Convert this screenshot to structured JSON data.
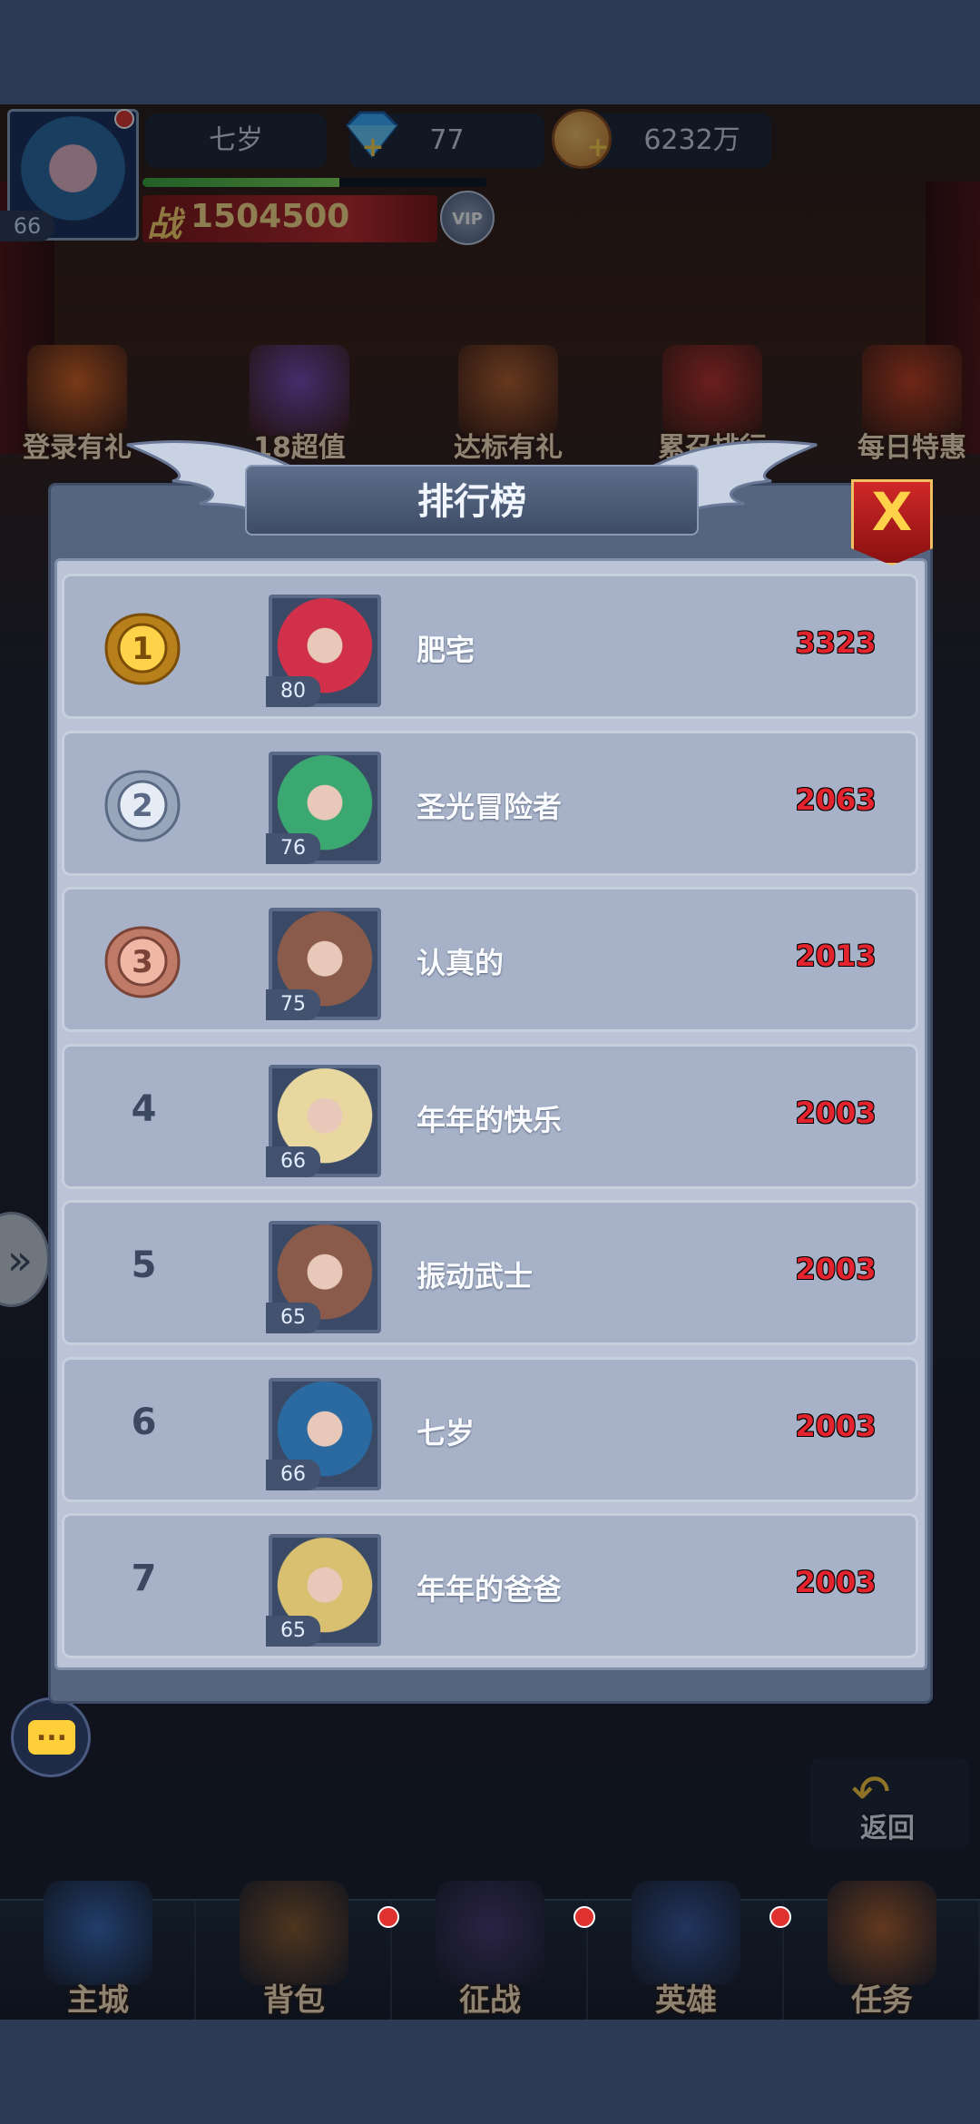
{
  "header": {
    "player_name": "七岁",
    "player_level": "66",
    "gems": "77",
    "coins": "6232万",
    "power_label": "战",
    "power_value": "1504500",
    "vip_label": "VIP",
    "xp_progress": 0.57
  },
  "events": [
    {
      "label": "登录有礼",
      "color": "#d8621e"
    },
    {
      "label": "18超值",
      "color": "#7a4bb8"
    },
    {
      "label": "达标有礼",
      "color": "#b8602a"
    },
    {
      "label": "累召排行",
      "color": "#c0302a"
    },
    {
      "label": "每日特惠",
      "color": "#c8401e"
    }
  ],
  "leaderboard": {
    "title": "排行榜",
    "close_label": "X",
    "rows": [
      {
        "rank": "1",
        "name": "肥宅",
        "score": "3323",
        "level": "80",
        "medal": "gold"
      },
      {
        "rank": "2",
        "name": "圣光冒险者",
        "score": "2063",
        "level": "76",
        "medal": "silver"
      },
      {
        "rank": "3",
        "name": "认真的",
        "score": "2013",
        "level": "75",
        "medal": "bronze"
      },
      {
        "rank": "4",
        "name": "年年的快乐",
        "score": "2003",
        "level": "66",
        "medal": ""
      },
      {
        "rank": "5",
        "name": "振动武士",
        "score": "2003",
        "level": "65",
        "medal": ""
      },
      {
        "rank": "6",
        "name": "七岁",
        "score": "2003",
        "level": "66",
        "medal": ""
      },
      {
        "rank": "7",
        "name": "年年的爸爸",
        "score": "2003",
        "level": "65",
        "medal": ""
      }
    ]
  },
  "chat_label": "...",
  "back_label": "返回",
  "bottom_nav": [
    {
      "label": "主城",
      "icon": "castle-icon",
      "dot": false
    },
    {
      "label": "背包",
      "icon": "backpack-icon",
      "dot": true
    },
    {
      "label": "征战",
      "icon": "dragon-portal-icon",
      "dot": true
    },
    {
      "label": "英雄",
      "icon": "helmet-icon",
      "dot": true
    },
    {
      "label": "任务",
      "icon": "scroll-icon",
      "dot": false
    }
  ]
}
